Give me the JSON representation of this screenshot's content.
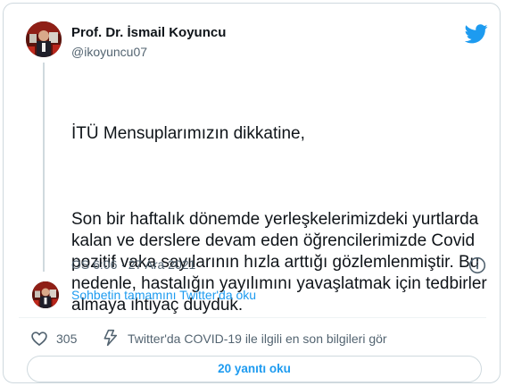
{
  "author": {
    "display_name": "Prof. Dr. İsmail Koyuncu",
    "handle": "@ikoyuncu07"
  },
  "tweet": {
    "greeting": "İTÜ Mensuplarımızın dikkatine,",
    "body": "Son bir haftalık dönemde yerleşkelerimizdeki yurtlarda kalan ve derslere devam eden öğrencilerimizde Covid pozitif vaka sayılarının hızla arttığı gözlemlenmiştir. Bu nedenle, hastalığın yayılımını yavaşlatmak için tedbirler almaya ihtiyaç duyduk.",
    "timestamp": "ÖS 6:06 · 27 Ara 2021"
  },
  "thread": {
    "link_text": "Sohbetin tamamını Twitter'da oku"
  },
  "actions": {
    "like_count": "305",
    "covid_text": "Twitter'da COVID-19 ile ilgili en son bilgileri gör",
    "replies_button": "20 yanıtı oku"
  },
  "icons": {
    "brand": "twitter-bird-icon",
    "info": "info-icon",
    "like": "heart-icon",
    "covid": "lightning-icon"
  },
  "colors": {
    "accent": "#1d9bf0",
    "text": "#0f1419",
    "secondary_text": "#536471",
    "border": "#cfd9de"
  }
}
